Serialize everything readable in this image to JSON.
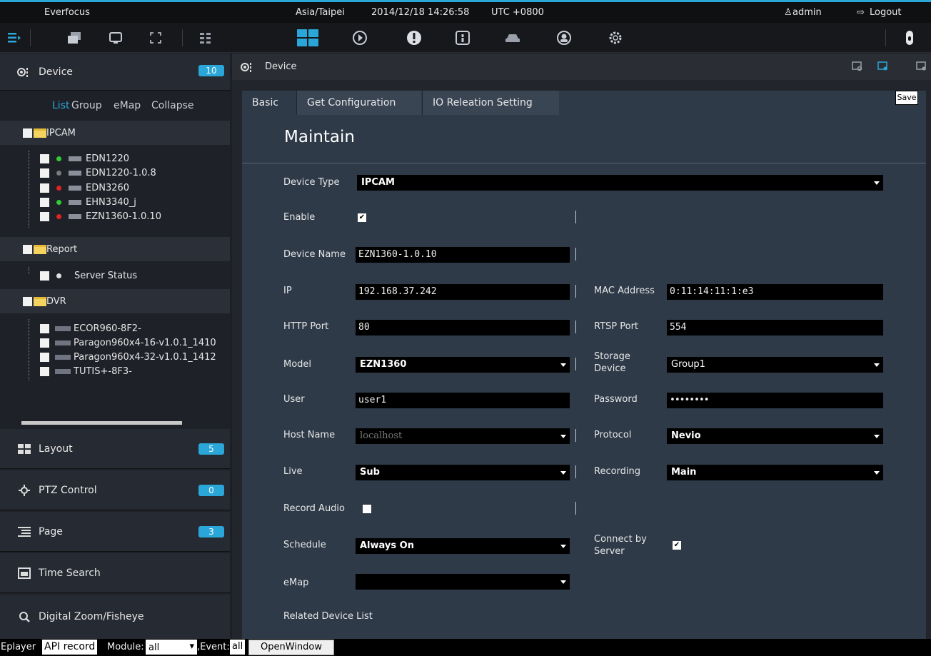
{
  "topbar": {
    "brand": "Everfocus",
    "timezone": "Asia/Taipei",
    "datetime": "2014/12/18 14:26:58",
    "utc": "UTC +0800",
    "user": "admin",
    "logout": "Logout"
  },
  "sidebar": {
    "device": {
      "title": "Device",
      "count": "10"
    },
    "subtabs": [
      "List",
      "Group",
      "eMap",
      "Collapse"
    ],
    "folders": [
      {
        "name": "IPCAM",
        "items": [
          {
            "name": "EDN1220",
            "status": "#34c934"
          },
          {
            "name": "EDN1220-1.0.8",
            "status": "#7a7a7a"
          },
          {
            "name": "EDN3260",
            "status": "#e02424"
          },
          {
            "name": "EHN3340_j",
            "status": "#34c934"
          },
          {
            "name": "EZN1360-1.0.10",
            "status": "#e02424"
          }
        ]
      },
      {
        "name": "Report",
        "items": [
          {
            "name": "Server Status",
            "status": "#e0e0e0"
          }
        ]
      },
      {
        "name": "DVR",
        "items": [
          {
            "name": "ECOR960-8F2-"
          },
          {
            "name": "Paragon960x4-16-v1.0.1_1410"
          },
          {
            "name": "Paragon960x4-32-v1.0.1_1412"
          },
          {
            "name": "TUTIS+-8F3-"
          }
        ]
      }
    ],
    "sections": [
      {
        "title": "Layout",
        "count": "5"
      },
      {
        "title": "PTZ Control",
        "count": "0"
      },
      {
        "title": "Page",
        "count": "3"
      },
      {
        "title": "Time Search",
        "count": ""
      },
      {
        "title": "Digital Zoom/Fisheye",
        "count": ""
      }
    ]
  },
  "panel": {
    "title": "Device",
    "tooltip": "Save",
    "tabs": [
      "Basic",
      "Get Configuration",
      "IO Releation Setting"
    ],
    "heading": "Maintain",
    "fields": {
      "device_type": {
        "label": "Device Type",
        "value": "IPCAM"
      },
      "enable": {
        "label": "Enable",
        "checked": true
      },
      "device_name": {
        "label": "Device Name",
        "value": "EZN1360-1.0.10"
      },
      "ip": {
        "label": "IP",
        "value": "192.168.37.242"
      },
      "mac": {
        "label": "MAC Address",
        "value": "0:11:14:11:1:e3"
      },
      "http_port": {
        "label": "HTTP Port",
        "value": "80"
      },
      "rtsp_port": {
        "label": "RTSP Port",
        "value": "554"
      },
      "model": {
        "label": "Model",
        "value": "EZN1360"
      },
      "storage": {
        "label": "Storage Device",
        "value": "Group1"
      },
      "user": {
        "label": "User",
        "value": "user1"
      },
      "password": {
        "label": "Password",
        "value": "••••••••"
      },
      "host": {
        "label": "Host Name",
        "value": "localhost"
      },
      "protocol": {
        "label": "Protocol",
        "value": "Nevio"
      },
      "live": {
        "label": "Live",
        "value": "Sub"
      },
      "recording": {
        "label": "Recording",
        "value": "Main"
      },
      "record_audio": {
        "label": "Record Audio",
        "checked": false
      },
      "schedule": {
        "label": "Schedule",
        "value": "Always On"
      },
      "connect_by_server": {
        "label": "Connect by Server",
        "checked": true
      },
      "emap": {
        "label": "eMap",
        "value": ""
      },
      "related": {
        "label": "Related Device List"
      }
    }
  },
  "bottombar": {
    "eplayer": "Eplayer",
    "api_record": "API record",
    "module_label": "Module:",
    "module_value": "all",
    "event_label": ",Event:",
    "event_value": "all",
    "open_window": "OpenWindow"
  },
  "colors": {
    "accent": "#2aa7d8",
    "panel": "#2e3a48",
    "active_tab": "#3a4554"
  }
}
